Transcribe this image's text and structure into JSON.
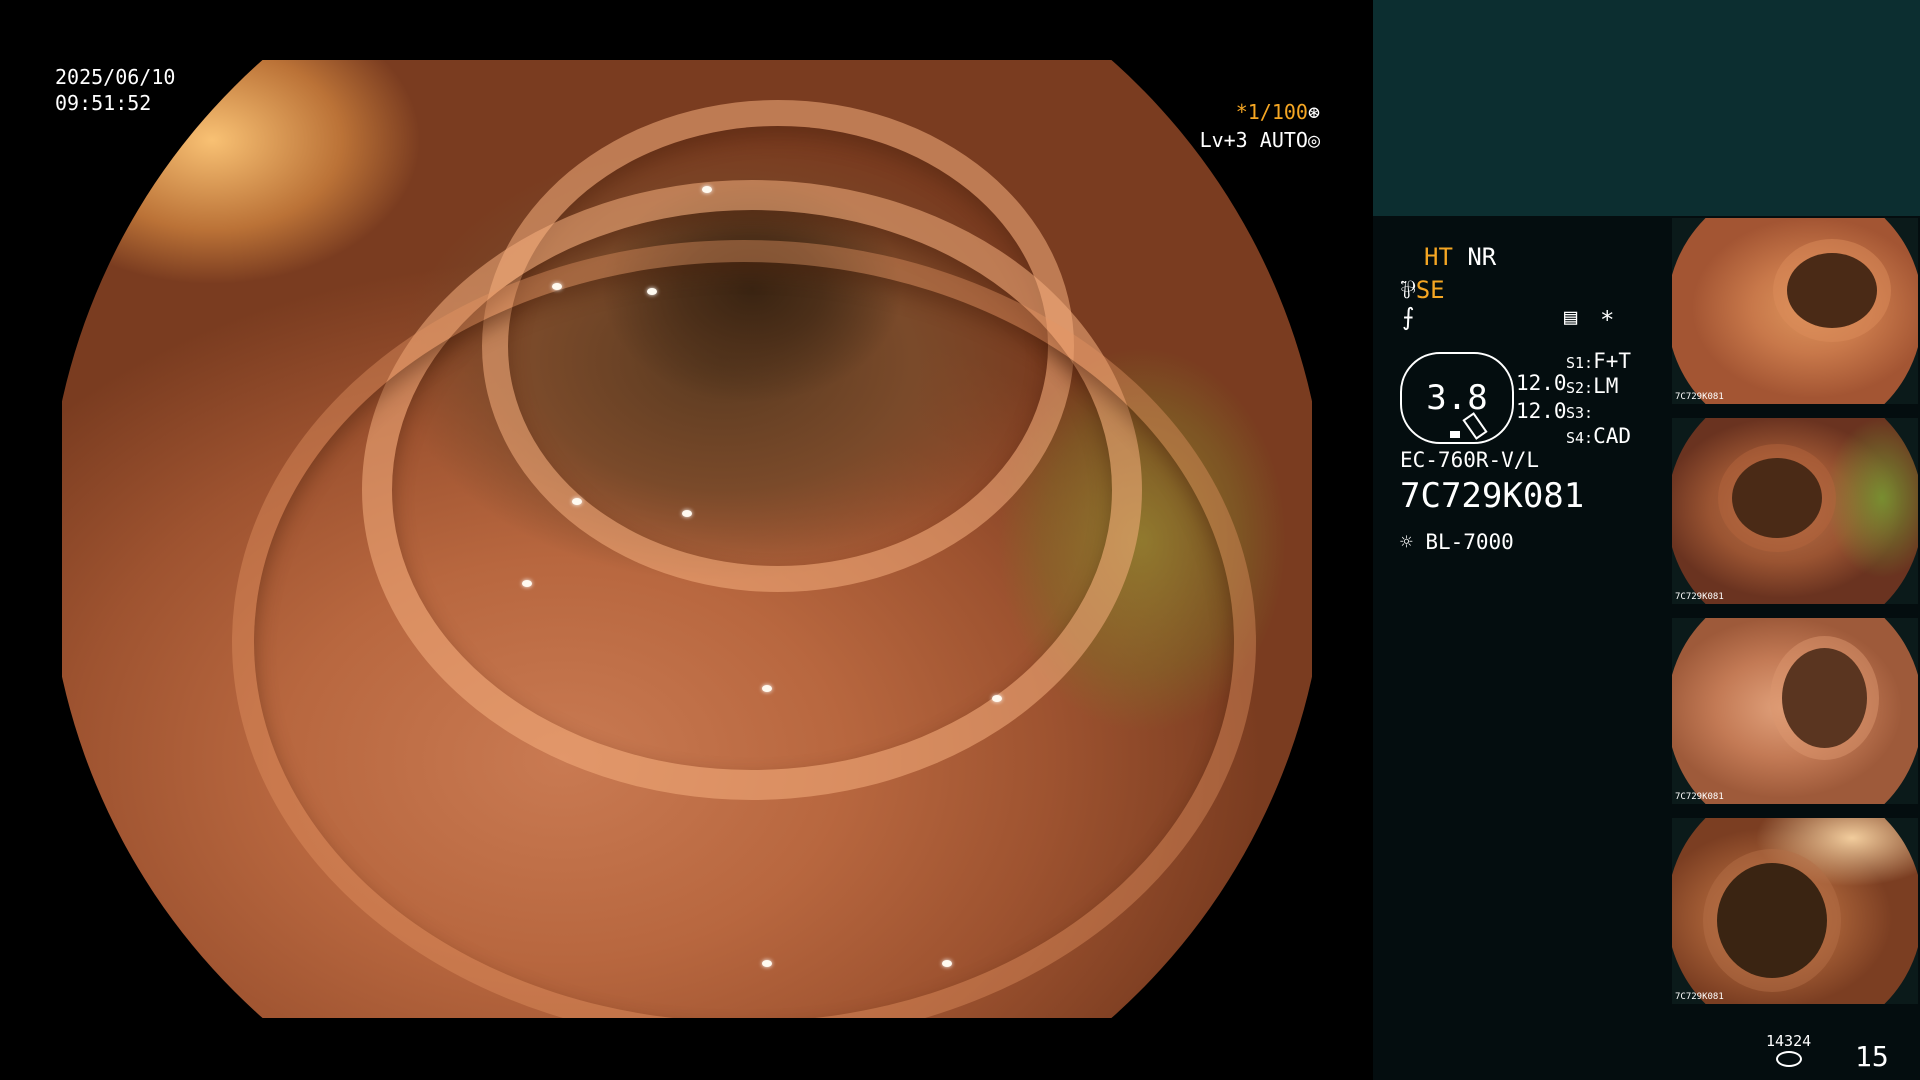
{
  "datetime": {
    "date": "2025/06/10",
    "time": "09:51:52"
  },
  "shutter": {
    "speed": "*1/100",
    "speed_icon": "aperture-icon"
  },
  "level": {
    "value": "Lv+3",
    "mode": "AUTO",
    "mode_icon": "iris-icon"
  },
  "modes": {
    "ht": "HT",
    "nr": "NR",
    "se_icon": "fork-icon",
    "se": "SE",
    "signal_icon": "signal-icon",
    "settings_icon": "settings-doc-icon",
    "asterisk": "*"
  },
  "capsule": {
    "value": "3.8"
  },
  "values": [
    "12.0",
    "12.0"
  ],
  "slots": [
    {
      "num": "S1:",
      "label": "F+T"
    },
    {
      "num": "S2:",
      "label": "LM"
    },
    {
      "num": "S3:",
      "label": ""
    },
    {
      "num": "S4:",
      "label": "CAD"
    }
  ],
  "scope": {
    "model": "EC-760R-V/L",
    "serial": "7C729K081"
  },
  "light": {
    "icon": "sun-icon",
    "name": "BL-7000"
  },
  "thumbnails": [
    {
      "label": "7C729K081"
    },
    {
      "label": "7C729K081"
    },
    {
      "label": "7C729K081"
    },
    {
      "label": "7C729K081"
    }
  ],
  "footer": {
    "count": "14324",
    "page": "15"
  }
}
